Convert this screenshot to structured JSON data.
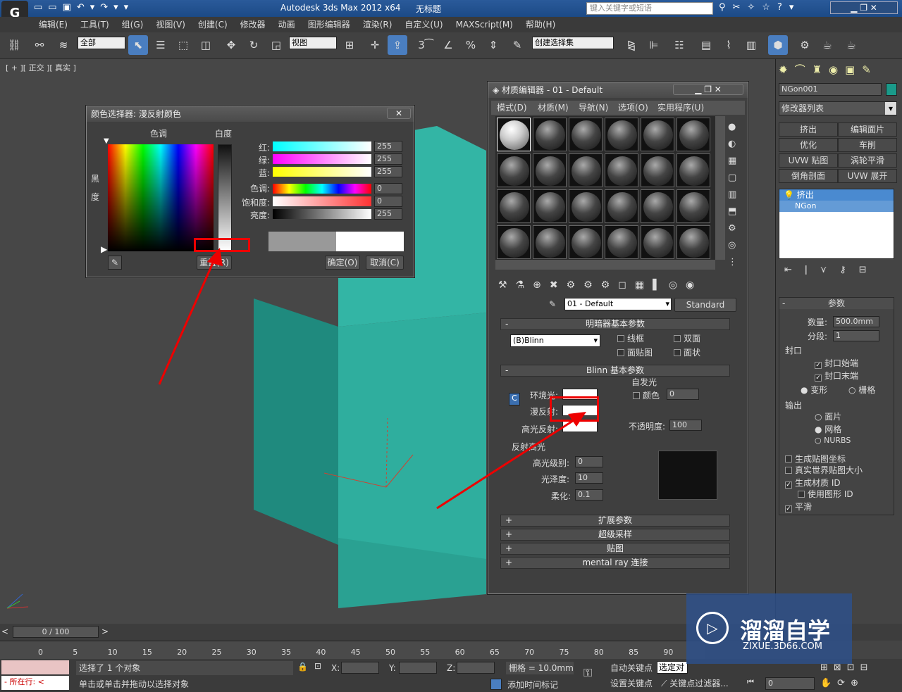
{
  "app": {
    "title": "Autodesk 3ds Max  2012 x64",
    "doc": "无标题",
    "search_placeholder": "键入关键字或短语"
  },
  "menu": [
    "编辑(E)",
    "工具(T)",
    "组(G)",
    "视图(V)",
    "创建(C)",
    "修改器",
    "动画",
    "图形编辑器",
    "渲染(R)",
    "自定义(U)",
    "MAXScript(M)",
    "帮助(H)"
  ],
  "toolbar": {
    "filter": "全部",
    "refcoord": "视图",
    "selset": "创建选择集"
  },
  "viewport": {
    "label": "[ + ][ 正交 ][ 真实 ]"
  },
  "color_picker": {
    "title": "颜色选择器: 漫反射颜色",
    "hue": "色调",
    "white": "白度",
    "black": "黑",
    "degree": "度",
    "rows": [
      {
        "label": "红:",
        "value": "255"
      },
      {
        "label": "绿:",
        "value": "255"
      },
      {
        "label": "蓝:",
        "value": "255"
      },
      {
        "label": "色调:",
        "value": "0"
      },
      {
        "label": "饱和度:",
        "value": "0"
      },
      {
        "label": "亮度:",
        "value": "255"
      }
    ],
    "reset": "重置(R)",
    "ok": "确定(O)",
    "cancel": "取消(C)"
  },
  "mat_editor": {
    "title": "材质编辑器 - 01 - Default",
    "menus": [
      "模式(D)",
      "材质(M)",
      "导航(N)",
      "选项(O)",
      "实用程序(U)"
    ],
    "mat_name": "01 - Default",
    "mat_type": "Standard",
    "shader_rollout": "明暗器基本参数",
    "shader": "(B)Blinn",
    "wire": "线框",
    "two_sided": "双面",
    "face_map": "面贴图",
    "faceted": "面状",
    "blinn_rollout": "Blinn 基本参数",
    "self_illum": "自发光",
    "color": "颜色",
    "self_val": "0",
    "ambient": "环境光:",
    "diffuse": "漫反射:",
    "specular": "高光反射:",
    "opacity": "不透明度:",
    "opacity_val": "100",
    "spec_hl": "反射高光",
    "spec_level": "高光级别:",
    "spec_level_val": "0",
    "gloss": "光泽度:",
    "gloss_val": "10",
    "soften": "柔化:",
    "soften_val": "0.1",
    "rollouts": [
      "扩展参数",
      "超级采样",
      "贴图",
      "mental ray 连接"
    ]
  },
  "cmd": {
    "obj_name": "NGon001",
    "mod_list": "修改器列表",
    "mods": [
      "挤出",
      "编辑面片",
      "优化",
      "车削",
      "UVW 贴图",
      "涡轮平滑",
      "倒角剖面",
      "UVW 展开"
    ],
    "stack": [
      "挤出",
      "NGon"
    ],
    "params": "参数",
    "amount_lbl": "数量:",
    "amount": "500.0mm",
    "segs_lbl": "分段:",
    "segs": "1",
    "capping": "封口",
    "cap_start": "封口始端",
    "cap_end": "封口末端",
    "morph": "变形",
    "grid": "栅格",
    "output": "输出",
    "patch": "面片",
    "mesh": "网格",
    "nurbs": "NURBS",
    "gen_map": "生成贴图坐标",
    "real_world": "真实世界贴图大小",
    "gen_mat": "生成材质 ID",
    "use_shape": "使用图形 ID",
    "smooth": "平滑"
  },
  "timeline": {
    "frame": "0 / 100",
    "ticks": [
      "0",
      "5",
      "10",
      "15",
      "20",
      "25",
      "30",
      "35",
      "40",
      "45",
      "50",
      "55",
      "60",
      "65",
      "70",
      "75",
      "80",
      "85",
      "90"
    ]
  },
  "status": {
    "sel": "选择了 1 个对象",
    "hint": "单击或单击并拖动以选择对象",
    "add_tag": "添加时间标记",
    "grid": "栅格 = 10.0mm",
    "auto_key": "自动关键点",
    "set_key": "设置关键点",
    "sel_obj": "选定对",
    "key_filter": "关键点过滤器...",
    "frame_val": "0",
    "now": "所在行:",
    "x": "X:",
    "y": "Y:",
    "z": "Z:"
  },
  "watermark": {
    "text": "溜溜自学",
    "url": "ZIXUE.3D66.COM"
  }
}
